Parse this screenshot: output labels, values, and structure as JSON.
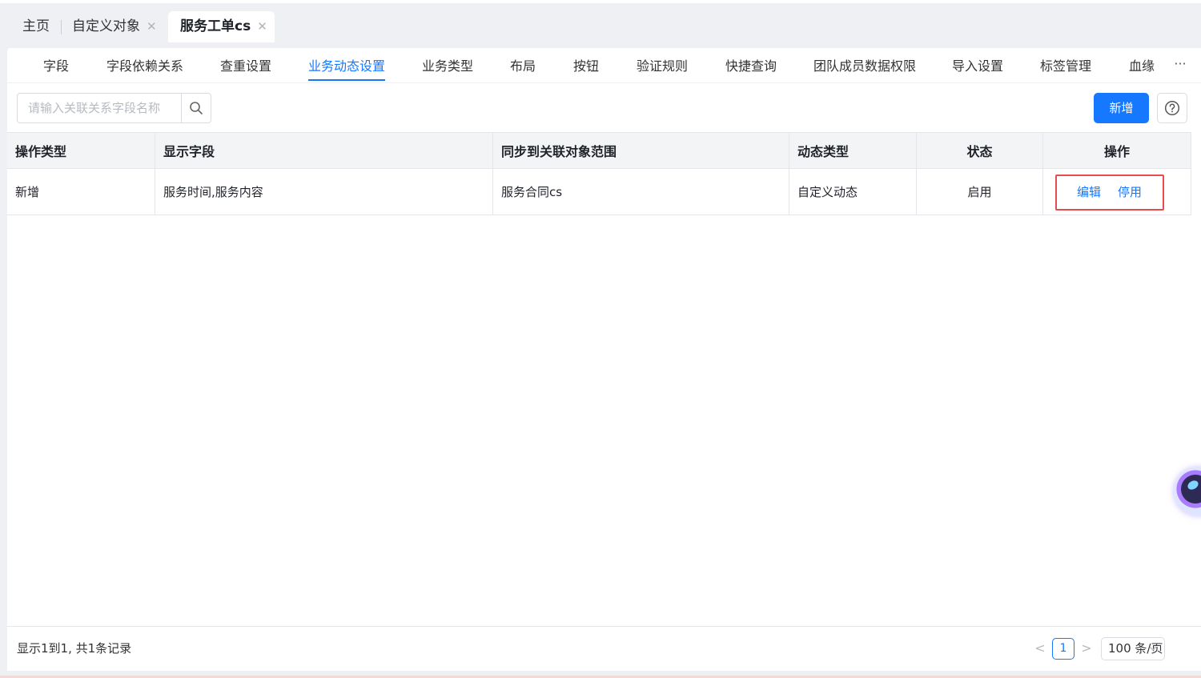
{
  "page_tabs": [
    {
      "label": "主页",
      "closable": false
    },
    {
      "label": "自定义对象",
      "closable": true
    },
    {
      "label": "服务工单cs",
      "closable": true,
      "active": true
    }
  ],
  "sub_tabs": [
    {
      "label": "字段"
    },
    {
      "label": "字段依赖关系"
    },
    {
      "label": "查重设置"
    },
    {
      "label": "业务动态设置",
      "active": true
    },
    {
      "label": "业务类型"
    },
    {
      "label": "布局"
    },
    {
      "label": "按钮"
    },
    {
      "label": "验证规则"
    },
    {
      "label": "快捷查询"
    },
    {
      "label": "团队成员数据权限"
    },
    {
      "label": "导入设置"
    },
    {
      "label": "标签管理"
    },
    {
      "label": "血缘"
    }
  ],
  "more_label": "···",
  "search": {
    "placeholder": "请输入关联关系字段名称",
    "value": ""
  },
  "toolbar": {
    "add_label": "新增",
    "help_icon": "question-circle-icon"
  },
  "table": {
    "columns": [
      "操作类型",
      "显示字段",
      "同步到关联对象范围",
      "动态类型",
      "状态",
      "操作"
    ],
    "rows": [
      {
        "op_type": "新增",
        "display_fields": "服务时间,服务内容",
        "sync_scope": "服务合同cs",
        "dynamic_type": "自定义动态",
        "status": "启用",
        "actions": [
          "编辑",
          "停用"
        ]
      }
    ]
  },
  "footer": {
    "summary": "显示1到1, 共1条记录",
    "current_page": "1",
    "page_size": "100 条/页",
    "prev": "<",
    "next": ">"
  },
  "colors": {
    "accent": "#1677ff",
    "highlight_box": "#e74c4c"
  }
}
